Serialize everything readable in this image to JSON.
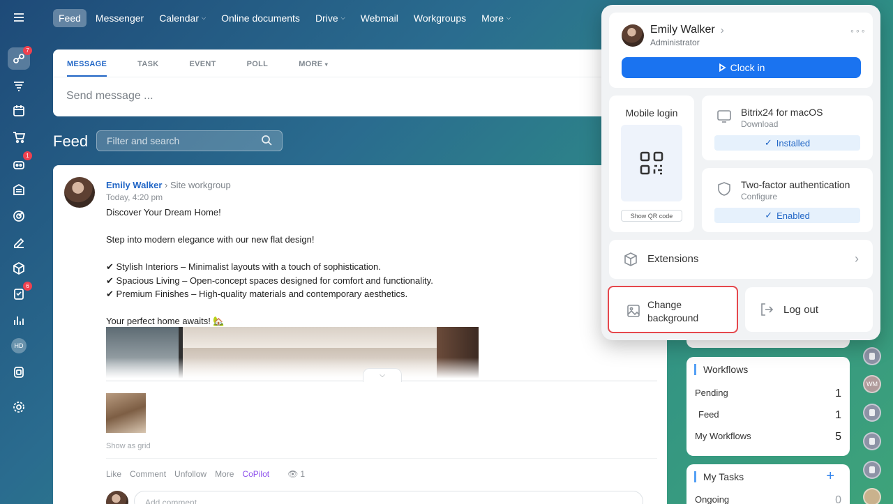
{
  "rail": {
    "badges": {
      "activity": "7",
      "inbox": "1",
      "tasks": "6"
    },
    "avatar_initials": "HD",
    "icons": [
      "menu-icon",
      "activity-icon",
      "filter-icon",
      "calendar-icon",
      "cart-icon",
      "robot-icon",
      "building-icon",
      "target-icon",
      "sign-icon",
      "cube-icon",
      "tasks-icon",
      "chart-icon",
      "hd-avatar",
      "contact-center-icon",
      "settings-icon"
    ]
  },
  "topnav": {
    "items": [
      {
        "label": "Feed"
      },
      {
        "label": "Messenger"
      },
      {
        "label": "Calendar"
      },
      {
        "label": "Online documents"
      },
      {
        "label": "Drive"
      },
      {
        "label": "Webmail"
      },
      {
        "label": "Workgroups"
      },
      {
        "label": "More"
      }
    ]
  },
  "composer": {
    "tabs": [
      "MESSAGE",
      "TASK",
      "EVENT",
      "POLL",
      "MORE"
    ],
    "placeholder": "Send message ..."
  },
  "feed": {
    "title": "Feed",
    "filter_placeholder": "Filter and search"
  },
  "post": {
    "author": "Emily Walker",
    "group": "Site workgroup",
    "time": "Today, 4:20 pm",
    "lines": [
      "Discover Your Dream Home!",
      "",
      "Step into modern elegance with our new flat design!",
      "",
      "✔ Stylish Interiors – Minimalist layouts with a touch of sophistication.",
      "✔ Spacious Living – Open-concept spaces designed for comfort and functionality.",
      "✔ Premium Finishes – High-quality materials and contemporary aesthetics.",
      "",
      "Your perfect home awaits! 🏡"
    ],
    "show_as_grid": "Show as grid",
    "actions": [
      "Like",
      "Comment",
      "Unfollow",
      "More",
      "CoPilot"
    ],
    "views": "1",
    "add_comment": "Add comment"
  },
  "widgets": {
    "workflows": {
      "title": "Workflows",
      "rows": [
        {
          "label": "Pending",
          "value": "1"
        },
        {
          "label": "Feed",
          "value": "1"
        },
        {
          "label": "My Workflows",
          "value": "5"
        }
      ]
    },
    "tasks": {
      "title": "My Tasks",
      "rows": [
        {
          "label": "Ongoing",
          "value": "0"
        }
      ]
    }
  },
  "right_avatars": {
    "initials_wm": "WM"
  },
  "popup": {
    "user_name": "Emily Walker",
    "user_role": "Administrator",
    "clock_in": "Clock in",
    "mobile_login": "Mobile login",
    "show_qr": "Show QR code",
    "desktop_app": {
      "title": "Bitrix24 for macOS",
      "sub": "Download",
      "status": "Installed"
    },
    "twofa": {
      "title": "Two-factor authentication",
      "sub": "Configure",
      "status": "Enabled"
    },
    "extensions": "Extensions",
    "change_background": "Change background",
    "log_out": "Log out"
  },
  "colors": {
    "accent": "#1a73f0",
    "link": "#2166c6",
    "highlight": "#e5484d",
    "badge": "#f0414f"
  }
}
